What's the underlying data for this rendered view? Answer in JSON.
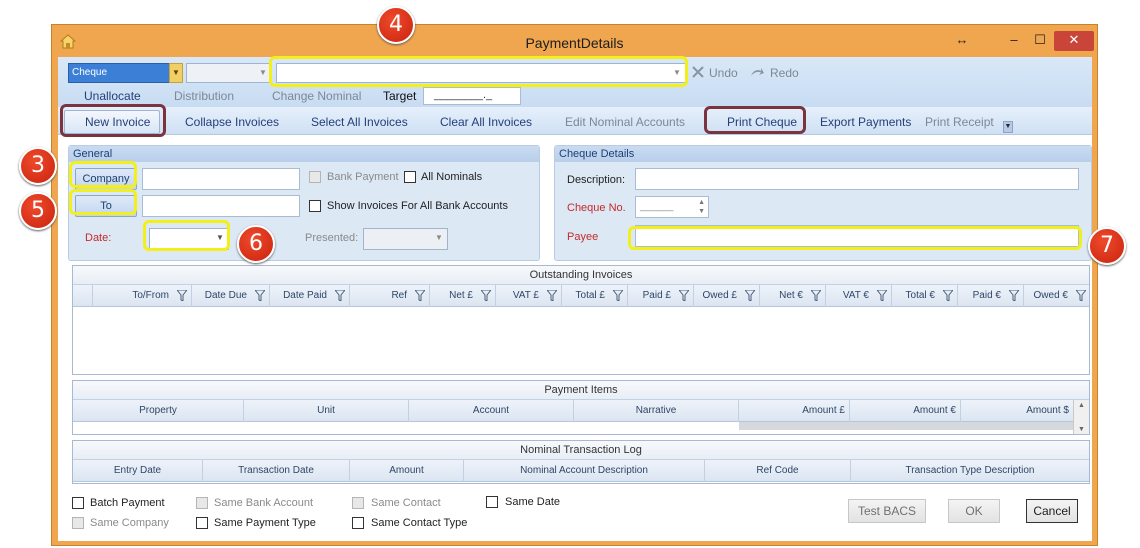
{
  "window": {
    "title": "PaymentDetails",
    "icon": "home-icon",
    "resize_glyph": "↔",
    "minimize_glyph": "–",
    "maximize_glyph": "☐",
    "close_glyph": "✕"
  },
  "toolbar": {
    "payment_type": "Cheque",
    "undo_label": "Undo",
    "redo_label": "Redo",
    "unallocate_label": "Unallocate",
    "distribution_label": "Distribution",
    "change_nominal_label": "Change Nominal",
    "target_label": "Target",
    "target_value": "________._"
  },
  "ribbon": {
    "items": [
      {
        "label": "New Invoice",
        "enabled": true
      },
      {
        "label": "Collapse Invoices",
        "enabled": true
      },
      {
        "label": "Select All Invoices",
        "enabled": true
      },
      {
        "label": "Clear All Invoices",
        "enabled": true
      },
      {
        "label": "Edit Nominal Accounts",
        "enabled": false
      },
      {
        "label": "Print Cheque",
        "enabled": true
      },
      {
        "label": "Export Payments",
        "enabled": true
      },
      {
        "label": "Print Receipt",
        "enabled": false
      }
    ]
  },
  "general": {
    "title": "General",
    "company_button": "Company",
    "to_button": "To",
    "bank_payment_label": "Bank Payment",
    "all_nominals_label": "All Nominals",
    "show_invoices_label": "Show Invoices For All Bank Accounts",
    "date_label": "Date:",
    "presented_label": "Presented:"
  },
  "cheque_details": {
    "title": "Cheque Details",
    "description_label": "Description:",
    "cheque_no_label": "Cheque No.",
    "cheque_no_value": "______",
    "payee_label": "Payee"
  },
  "outstanding_invoices": {
    "title": "Outstanding Invoices",
    "columns": [
      "To/From",
      "Date Due",
      "Date Paid",
      "Ref",
      "Net £",
      "VAT £",
      "Total £",
      "Paid £",
      "Owed £",
      "Net €",
      "VAT €",
      "Total €",
      "Paid €",
      "Owed €"
    ]
  },
  "payment_items": {
    "title": "Payment Items",
    "columns": [
      "Property",
      "Unit",
      "Account",
      "Narrative",
      "Amount £",
      "Amount €",
      "Amount $"
    ]
  },
  "nominal_log": {
    "title": "Nominal Transaction Log",
    "columns": [
      "Entry Date",
      "Transaction Date",
      "Amount",
      "Nominal Account Description",
      "Ref Code",
      "Transaction Type Description"
    ]
  },
  "options": {
    "batch_payment": "Batch Payment",
    "same_company": "Same Company",
    "same_bank_account": "Same Bank Account",
    "same_payment_type": "Same Payment Type",
    "same_contact": "Same Contact",
    "same_contact_type": "Same Contact Type",
    "same_date": "Same Date"
  },
  "footer": {
    "test_bacs": "Test BACS",
    "ok": "OK",
    "cancel": "Cancel"
  },
  "callouts": [
    "3",
    "4",
    "5",
    "6",
    "7"
  ],
  "colors": {
    "frame": "#f0a64e",
    "highlight_yellow": "#f2ef1a",
    "highlight_maroon": "#7a3440",
    "badge_red": "#d9301a",
    "required_label": "#c42a2a"
  }
}
